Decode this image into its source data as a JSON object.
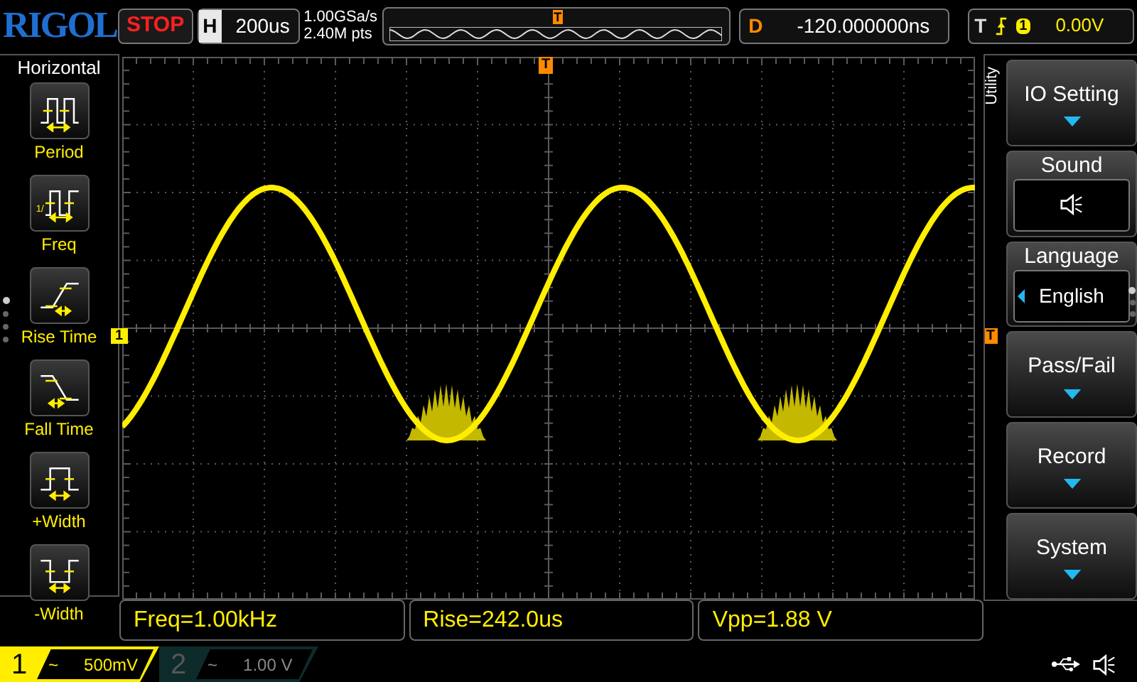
{
  "logo": "RIGOL",
  "run_state": "STOP",
  "horizontal": {
    "label": "H",
    "timebase": "200us"
  },
  "sample_rate": "1.00GSa/s",
  "memory_depth": "2.40M pts",
  "overview": {
    "trigger_marker": "T"
  },
  "delay": {
    "label": "D",
    "value": "-120.000000ns"
  },
  "trigger": {
    "label": "T",
    "source": "1",
    "value": "0.00V"
  },
  "left_menu": {
    "title": "Horizontal",
    "pages": [
      {
        "selected": true
      },
      {
        "selected": false
      },
      {
        "selected": false
      },
      {
        "selected": false
      }
    ],
    "items": [
      {
        "kind": "period",
        "label": "Period"
      },
      {
        "kind": "freq",
        "label": "Freq",
        "icon_text": "1/"
      },
      {
        "kind": "rise",
        "label": "Rise Time"
      },
      {
        "kind": "fall",
        "label": "Fall Time"
      },
      {
        "kind": "pwidth",
        "label": "+Width"
      },
      {
        "kind": "nwidth",
        "label": "-Width"
      }
    ]
  },
  "graticule": {
    "trigger_position_marker": "T",
    "channel_marker": "1",
    "trigger_level_marker": "T"
  },
  "right_menu": {
    "title": "Utility",
    "pages": [
      {
        "selected": true
      },
      {
        "selected": false
      },
      {
        "selected": false
      }
    ],
    "items": [
      {
        "kind": "submenu",
        "label": "IO Setting"
      },
      {
        "kind": "icon",
        "label": "Sound",
        "on": true
      },
      {
        "kind": "select",
        "label": "Language",
        "value": "English"
      },
      {
        "kind": "submenu",
        "label": "Pass/Fail"
      },
      {
        "kind": "submenu",
        "label": "Record"
      },
      {
        "kind": "submenu",
        "label": "System"
      }
    ]
  },
  "measurements": [
    "Freq=1.00kHz",
    "Rise=242.0us",
    "Vpp=1.88 V"
  ],
  "channels": [
    {
      "number": "1",
      "coupling": "~",
      "scale": "500mV",
      "enabled": true
    },
    {
      "number": "2",
      "coupling": "~",
      "scale": "1.00 V",
      "enabled": false
    }
  ]
}
